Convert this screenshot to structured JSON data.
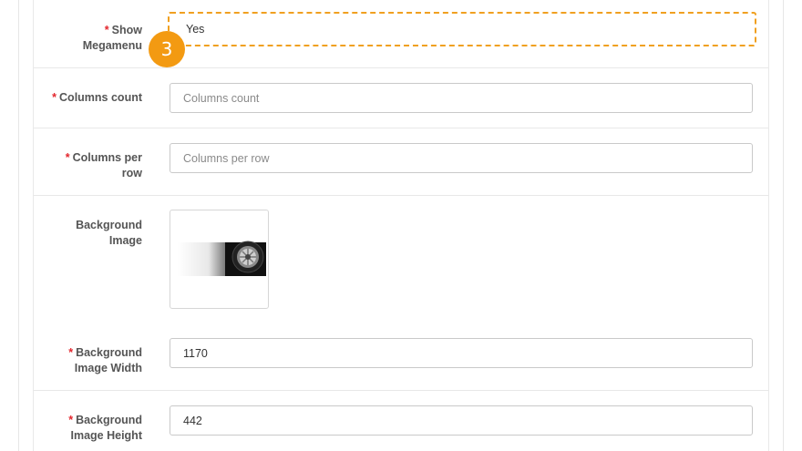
{
  "form": {
    "show_megamenu": {
      "required_mark": "*",
      "label_line1": "Show",
      "label_line2": "Megamenu",
      "value": "Yes",
      "step_badge": "3"
    },
    "columns_count": {
      "required_mark": "*",
      "label": "Columns count",
      "placeholder": "Columns count"
    },
    "columns_per_row": {
      "required_mark": "*",
      "label_line1": "Columns per",
      "label_line2": "row",
      "placeholder": "Columns per row"
    },
    "background_image": {
      "label_line1": "Background",
      "label_line2": "Image"
    },
    "background_image_width": {
      "required_mark": "*",
      "label_line1": "Background",
      "label_line2": "Image Width",
      "value": "1170"
    },
    "background_image_height": {
      "required_mark": "*",
      "label_line1": "Background",
      "label_line2": "Image Height",
      "value": "442"
    }
  },
  "colors": {
    "accent": "#f39a12",
    "required": "#e3262d",
    "highlight_border": "#f0a020"
  }
}
